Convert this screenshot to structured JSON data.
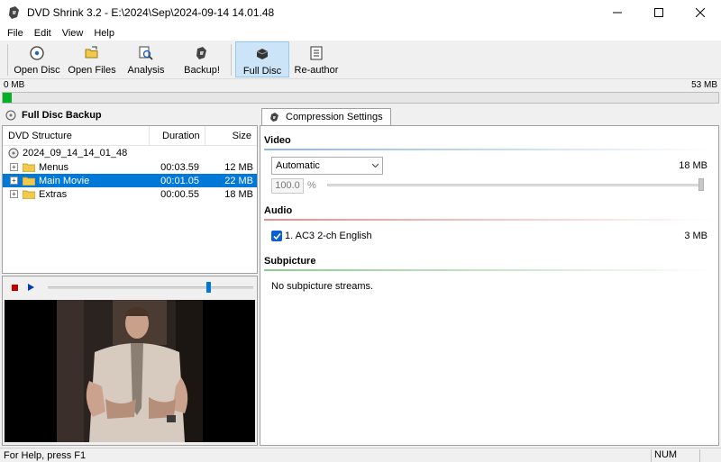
{
  "window": {
    "title": "DVD Shrink 3.2 - E:\\2024\\Sep\\2024-09-14 14.01.48"
  },
  "menu": [
    "File",
    "Edit",
    "View",
    "Help"
  ],
  "toolbar": {
    "open_disc": "Open Disc",
    "open_files": "Open Files",
    "analysis": "Analysis",
    "backup": "Backup!",
    "full_disc": "Full Disc",
    "reauthor": "Re-author"
  },
  "sizebar": {
    "min_label": "0 MB",
    "max_label": "53 MB",
    "fill_fraction": 0.012,
    "fill_color": "#06b025"
  },
  "left": {
    "header": "Full Disc Backup",
    "columns": {
      "name": "DVD Structure",
      "duration": "Duration",
      "size": "Size"
    },
    "root": "2024_09_14_14_01_48",
    "rows": [
      {
        "name": "Menus",
        "duration": "00:03.59",
        "size": "12 MB",
        "selected": false
      },
      {
        "name": "Main Movie",
        "duration": "00:01.05",
        "size": "22 MB",
        "selected": true
      },
      {
        "name": "Extras",
        "duration": "00:00.55",
        "size": "18 MB",
        "selected": false
      }
    ],
    "player": {
      "seek_fraction": 0.78
    }
  },
  "right": {
    "tab": "Compression Settings",
    "video": {
      "title": "Video",
      "mode": "Automatic",
      "size": "18 MB",
      "percent": "100.0",
      "percent_sign": "%",
      "line_color": "#8cb4e6"
    },
    "audio": {
      "title": "Audio",
      "track": "1. AC3 2-ch English",
      "size": "3 MB",
      "checked": true,
      "line_color": "#e88c8c"
    },
    "subpicture": {
      "title": "Subpicture",
      "text": "No subpicture streams.",
      "line_color": "#8ccc8c"
    }
  },
  "status": {
    "help": "For Help, press F1",
    "num": "NUM"
  },
  "colors": {
    "selection": "#0078d7",
    "accent": "#0078d7"
  }
}
